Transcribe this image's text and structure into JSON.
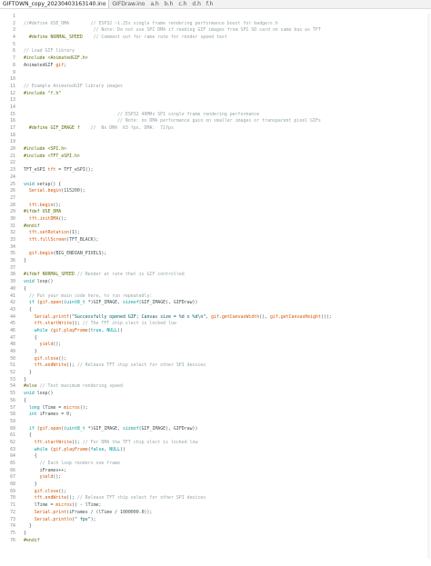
{
  "tabs": [
    {
      "label": "GIFTOWN_copy_20230403163140.ino",
      "active": true
    },
    {
      "label": "GIFDraw.ino",
      "active": false
    },
    {
      "label": "a.h",
      "active": false
    },
    {
      "label": "b.h",
      "active": false
    },
    {
      "label": "c.h",
      "active": false
    },
    {
      "label": "d.h",
      "active": false
    },
    {
      "label": "f.h",
      "active": false
    }
  ],
  "colors": {
    "comment": "#95a5a6",
    "keyword": "#00979c",
    "function": "#d35400",
    "preprocessor": "#5e6d03",
    "string": "#005c5f",
    "text": "#434f54"
  },
  "lines": [
    {
      "n": "1",
      "t": ""
    },
    {
      "n": "2",
      "t": "//#define USE_DMA        // ESP32 ~1.25x single frame rendering performance boost for badgers.h"
    },
    {
      "n": "3",
      "t": "                          // Note: Do not use SPI DMA if reading GIF images from SPI SD card on same bus as TFT"
    },
    {
      "n": "4",
      "t": "  #define NORMAL_SPEED    // Comment out for rame rate for render speed test"
    },
    {
      "n": "5",
      "t": ""
    },
    {
      "n": "6",
      "t": "// Load GIF library"
    },
    {
      "n": "7",
      "t": "#include <AnimatedGIF.h>"
    },
    {
      "n": "8",
      "t": "AnimatedGIF gif;"
    },
    {
      "n": "9",
      "t": ""
    },
    {
      "n": "10",
      "t": ""
    },
    {
      "n": "11",
      "t": "// Example AnimatedGIF library images"
    },
    {
      "n": "12",
      "t": "#include \"f.h\""
    },
    {
      "n": "13",
      "t": ""
    },
    {
      "n": "14",
      "t": ""
    },
    {
      "n": "15",
      "t": "                                   // ESP32 40MHz SPI single frame rendering performance"
    },
    {
      "n": "16",
      "t": "                                   // Note: no DMA performance gain on smaller images or transparent pixel GIFs"
    },
    {
      "n": "17",
      "t": "  #define GIF_IMAGE f    //  No DMA  63 fps, DMA:  71fps"
    },
    {
      "n": "18",
      "t": ""
    },
    {
      "n": "19",
      "t": ""
    },
    {
      "n": "20",
      "t": "#include <SPI.h>"
    },
    {
      "n": "21",
      "t": "#include <TFT_eSPI.h>"
    },
    {
      "n": "22",
      "t": ""
    },
    {
      "n": "23",
      "t": "TFT_eSPI tft = TFT_eSPI();"
    },
    {
      "n": "24",
      "t": ""
    },
    {
      "n": "25",
      "t": "void setup() {"
    },
    {
      "n": "26",
      "t": "  Serial.begin(115200);"
    },
    {
      "n": "27",
      "t": ""
    },
    {
      "n": "28",
      "t": "  tft.begin();"
    },
    {
      "n": "29",
      "t": "#ifdef USE_DMA"
    },
    {
      "n": "30",
      "t": "  tft.initDMA();"
    },
    {
      "n": "31",
      "t": "#endif"
    },
    {
      "n": "32",
      "t": "  tft.setRotation(1);"
    },
    {
      "n": "33",
      "t": "  tft.fillScreen(TFT_BLACK);"
    },
    {
      "n": "34",
      "t": ""
    },
    {
      "n": "35",
      "t": "  gif.begin(BIG_ENDIAN_PIXELS);"
    },
    {
      "n": "36",
      "t": "}"
    },
    {
      "n": "37",
      "t": ""
    },
    {
      "n": "38",
      "t": "#ifdef NORMAL_SPEED // Render at rate that is GIF controlled"
    },
    {
      "n": "39",
      "t": "void loop()"
    },
    {
      "n": "40",
      "t": "{"
    },
    {
      "n": "41",
      "t": "  // Put your main code here, to run repeatedly:"
    },
    {
      "n": "42",
      "t": "  if (gif.open((uint8_t *)GIF_IMAGE, sizeof(GIF_IMAGE), GIFDraw))"
    },
    {
      "n": "43",
      "t": "  {"
    },
    {
      "n": "44",
      "t": "    Serial.printf(\"Successfully opened GIF; Canvas size = %d x %d\\n\", gif.getCanvasWidth(), gif.getCanvasHeight());"
    },
    {
      "n": "45",
      "t": "    tft.startWrite(); // The TFT chip slect is locked low"
    },
    {
      "n": "46",
      "t": "    while (gif.playFrame(true, NULL))"
    },
    {
      "n": "47",
      "t": "    {"
    },
    {
      "n": "48",
      "t": "      yield();"
    },
    {
      "n": "49",
      "t": "    }"
    },
    {
      "n": "50",
      "t": "    gif.close();"
    },
    {
      "n": "51",
      "t": "    tft.endWrite(); // Release TFT chip select for other SPI devices"
    },
    {
      "n": "52",
      "t": "  }"
    },
    {
      "n": "53",
      "t": "}"
    },
    {
      "n": "54",
      "t": "#else // Test maximum rendering speed"
    },
    {
      "n": "55",
      "t": "void loop()"
    },
    {
      "n": "56",
      "t": "{"
    },
    {
      "n": "57",
      "t": "  long lTime = micros();"
    },
    {
      "n": "58",
      "t": "  int iFrames = 0;"
    },
    {
      "n": "59",
      "t": ""
    },
    {
      "n": "60",
      "t": "  if (gif.open((uint8_t *)GIF_IMAGE, sizeof(GIF_IMAGE), GIFDraw))"
    },
    {
      "n": "61",
      "t": "  {"
    },
    {
      "n": "62",
      "t": "    tft.startWrite(); // For DMA the TFT chip slect is locked low"
    },
    {
      "n": "63",
      "t": "    while (gif.playFrame(false, NULL))"
    },
    {
      "n": "64",
      "t": "    {"
    },
    {
      "n": "65",
      "t": "      // Each loop renders one frame"
    },
    {
      "n": "66",
      "t": "      iFrames++;"
    },
    {
      "n": "67",
      "t": "      yield();"
    },
    {
      "n": "68",
      "t": "    }"
    },
    {
      "n": "69",
      "t": "    gif.close();"
    },
    {
      "n": "70",
      "t": "    tft.endWrite(); // Release TFT chip select for other SPI devices"
    },
    {
      "n": "71",
      "t": "    lTime = micros() - lTime;"
    },
    {
      "n": "72",
      "t": "    Serial.print(iFrames / (lTime / 1000000.0));"
    },
    {
      "n": "73",
      "t": "    Serial.println(\" fps\");"
    },
    {
      "n": "74",
      "t": "  }"
    },
    {
      "n": "75",
      "t": "}"
    },
    {
      "n": "76",
      "t": "#endif"
    }
  ]
}
